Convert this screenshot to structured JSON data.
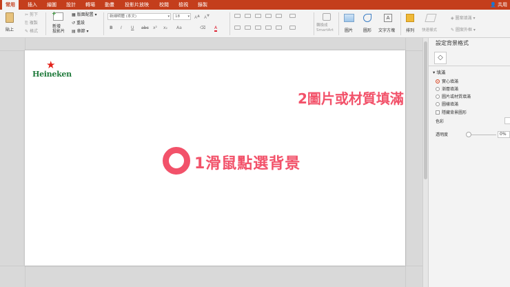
{
  "tabs": [
    "常用",
    "插入",
    "繪圖",
    "設計",
    "轉場",
    "動畫",
    "投影片放映",
    "校閱",
    "檢視",
    "錄製"
  ],
  "active_tab": "常用",
  "share_label": "共用",
  "ribbon": {
    "paste": "貼上",
    "cut": "剪下",
    "copy": "複製",
    "format_painter": "格式",
    "new_slide": "新增\n投影片",
    "layout": "版面配置",
    "reset": "重設",
    "section": "章節",
    "font_name": "新細明體 (本文)",
    "font_size": "18",
    "convert_smartart": "轉換成\nSmartArt",
    "picture": "圖片",
    "shapes": "圖形",
    "textbox": "文字方塊",
    "arrange": "排列",
    "quick_styles": "快速樣式",
    "shape_fill": "圖案填滿",
    "shape_outline": "圖案外框"
  },
  "format_buttons": [
    "B",
    "I",
    "U",
    "abc",
    "x²",
    "x₂",
    "Aa",
    "A"
  ],
  "slide": {
    "logo_text": "Heineken",
    "annotation_step1": "1滑鼠點選背景"
  },
  "pane": {
    "title": "設定背景格式",
    "fill_section": "填滿",
    "options": [
      {
        "label": "實心填滿",
        "selected": true
      },
      {
        "label": "漸層填滿",
        "selected": false
      },
      {
        "label": "圖片或材質填滿",
        "selected": false
      },
      {
        "label": "圖樣填滿",
        "selected": false
      }
    ],
    "hide_bg": "隱藏背景圖形",
    "color_label": "色彩",
    "transparency_label": "透明度",
    "transparency_value": "0%"
  },
  "annotation_step2": "2圖片或材質填滿",
  "colors": {
    "ribbon_red": "#c43e1c",
    "annotation_pink": "#f2526a",
    "logo_green": "#1f7a3b",
    "logo_star": "#e3231b"
  }
}
